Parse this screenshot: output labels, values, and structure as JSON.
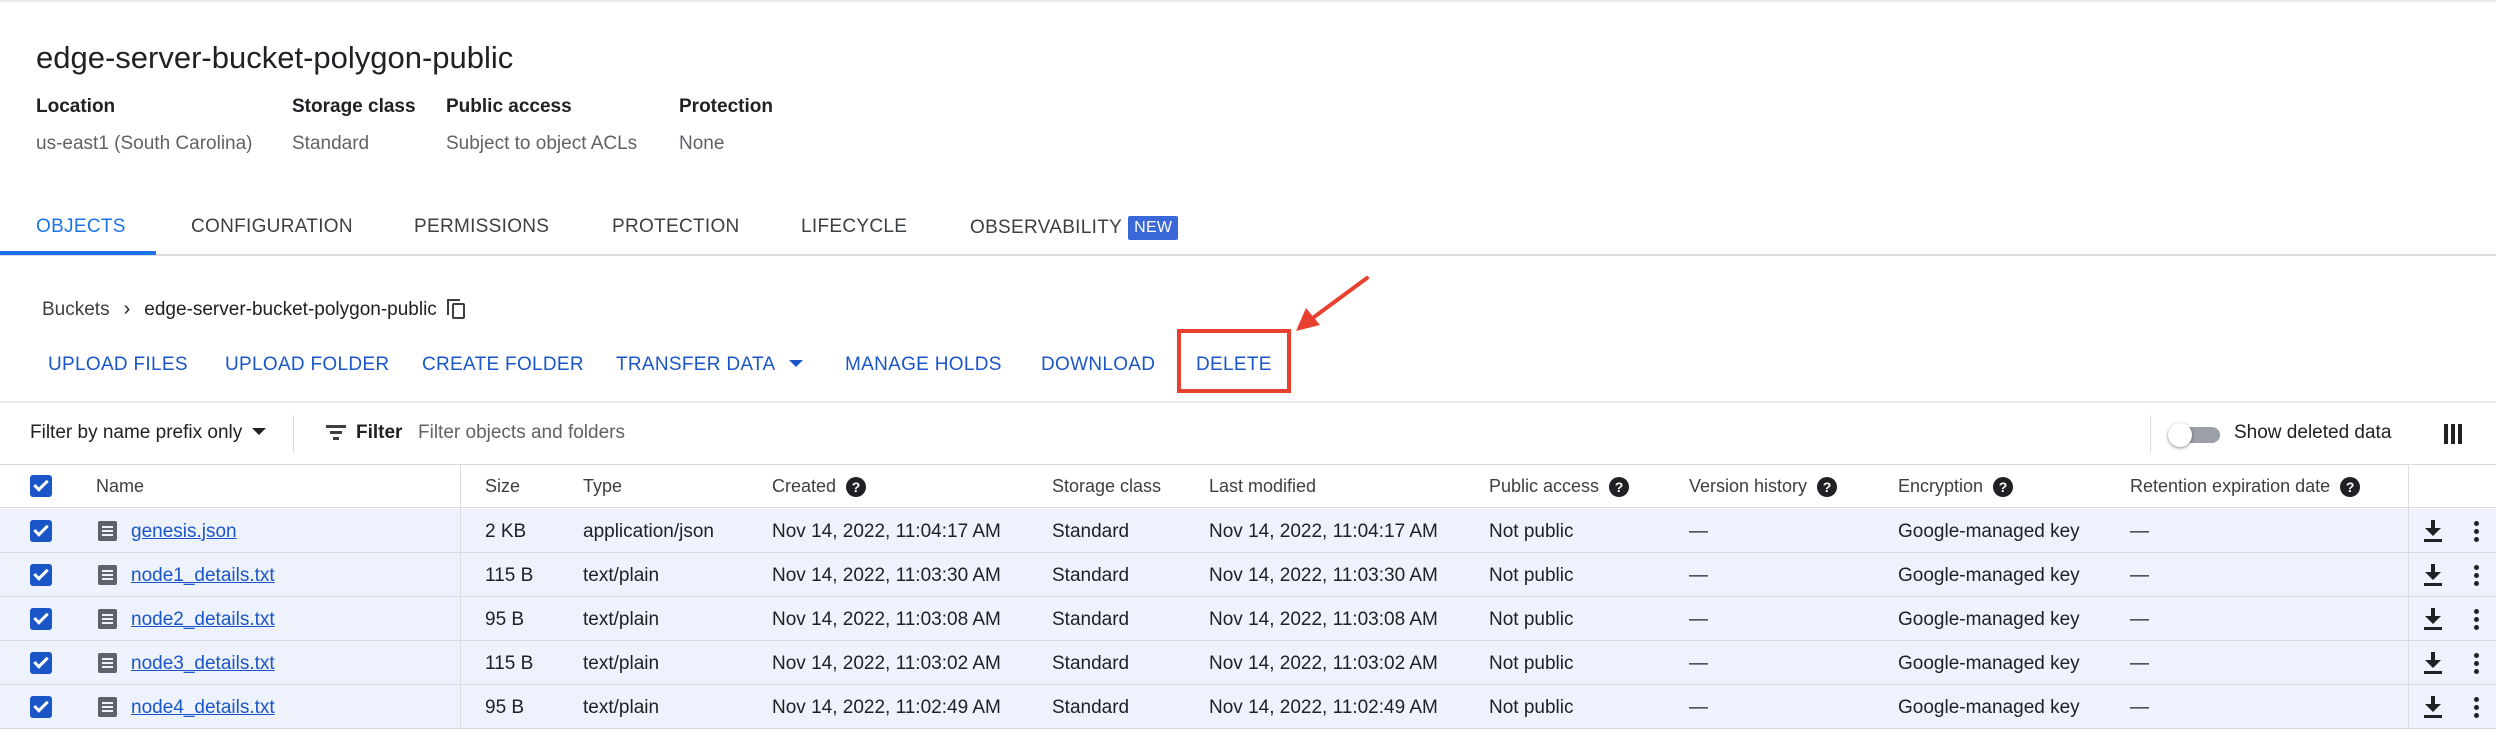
{
  "bucket": {
    "title": "edge-server-bucket-polygon-public",
    "properties": [
      {
        "label": "Location",
        "value": "us-east1 (South Carolina)"
      },
      {
        "label": "Storage class",
        "value": "Standard"
      },
      {
        "label": "Public access",
        "value": "Subject to object ACLs"
      },
      {
        "label": "Protection",
        "value": "None"
      }
    ]
  },
  "tabs": [
    {
      "label": "OBJECTS",
      "active": true
    },
    {
      "label": "CONFIGURATION"
    },
    {
      "label": "PERMISSIONS"
    },
    {
      "label": "PROTECTION"
    },
    {
      "label": "LIFECYCLE"
    },
    {
      "label": "OBSERVABILITY",
      "badge": "NEW"
    }
  ],
  "breadcrumb": {
    "root": "Buckets",
    "separator": "›",
    "current": "edge-server-bucket-polygon-public"
  },
  "actions": [
    "UPLOAD FILES",
    "UPLOAD FOLDER",
    "CREATE FOLDER",
    "TRANSFER DATA",
    "MANAGE HOLDS",
    "DOWNLOAD",
    "DELETE"
  ],
  "annotation_color": "#e8412f",
  "filter": {
    "prefix_label": "Filter by name prefix only",
    "filter_label": "Filter",
    "placeholder": "Filter objects and folders",
    "toggle_label": "Show deleted data",
    "toggle_on": false
  },
  "table": {
    "columns": [
      {
        "label": "Name"
      },
      {
        "label": "Size"
      },
      {
        "label": "Type"
      },
      {
        "label": "Created",
        "help": true
      },
      {
        "label": "Storage class"
      },
      {
        "label": "Last modified"
      },
      {
        "label": "Public access",
        "help": true
      },
      {
        "label": "Version history",
        "help": true
      },
      {
        "label": "Encryption",
        "help": true
      },
      {
        "label": "Retention expiration date",
        "help": true
      }
    ],
    "help_glyph": "?",
    "rows": [
      {
        "name": "genesis.json",
        "size": "2 KB",
        "type": "application/json",
        "created": "Nov 14, 2022, 11:04:17 AM",
        "storage_class": "Standard",
        "last_modified": "Nov 14, 2022, 11:04:17 AM",
        "public_access": "Not public",
        "version_history": "—",
        "encryption": "Google-managed key",
        "retention": "—",
        "checked": true
      },
      {
        "name": "node1_details.txt",
        "size": "115 B",
        "type": "text/plain",
        "created": "Nov 14, 2022, 11:03:30 AM",
        "storage_class": "Standard",
        "last_modified": "Nov 14, 2022, 11:03:30 AM",
        "public_access": "Not public",
        "version_history": "—",
        "encryption": "Google-managed key",
        "retention": "—",
        "checked": true
      },
      {
        "name": "node2_details.txt",
        "size": "95 B",
        "type": "text/plain",
        "created": "Nov 14, 2022, 11:03:08 AM",
        "storage_class": "Standard",
        "last_modified": "Nov 14, 2022, 11:03:08 AM",
        "public_access": "Not public",
        "version_history": "—",
        "encryption": "Google-managed key",
        "retention": "—",
        "checked": true
      },
      {
        "name": "node3_details.txt",
        "size": "115 B",
        "type": "text/plain",
        "created": "Nov 14, 2022, 11:03:02 AM",
        "storage_class": "Standard",
        "last_modified": "Nov 14, 2022, 11:03:02 AM",
        "public_access": "Not public",
        "version_history": "—",
        "encryption": "Google-managed key",
        "retention": "—",
        "checked": true
      },
      {
        "name": "node4_details.txt",
        "size": "95 B",
        "type": "text/plain",
        "created": "Nov 14, 2022, 11:02:49 AM",
        "storage_class": "Standard",
        "last_modified": "Nov 14, 2022, 11:02:49 AM",
        "public_access": "Not public",
        "version_history": "—",
        "encryption": "Google-managed key",
        "retention": "—",
        "checked": true
      }
    ]
  }
}
